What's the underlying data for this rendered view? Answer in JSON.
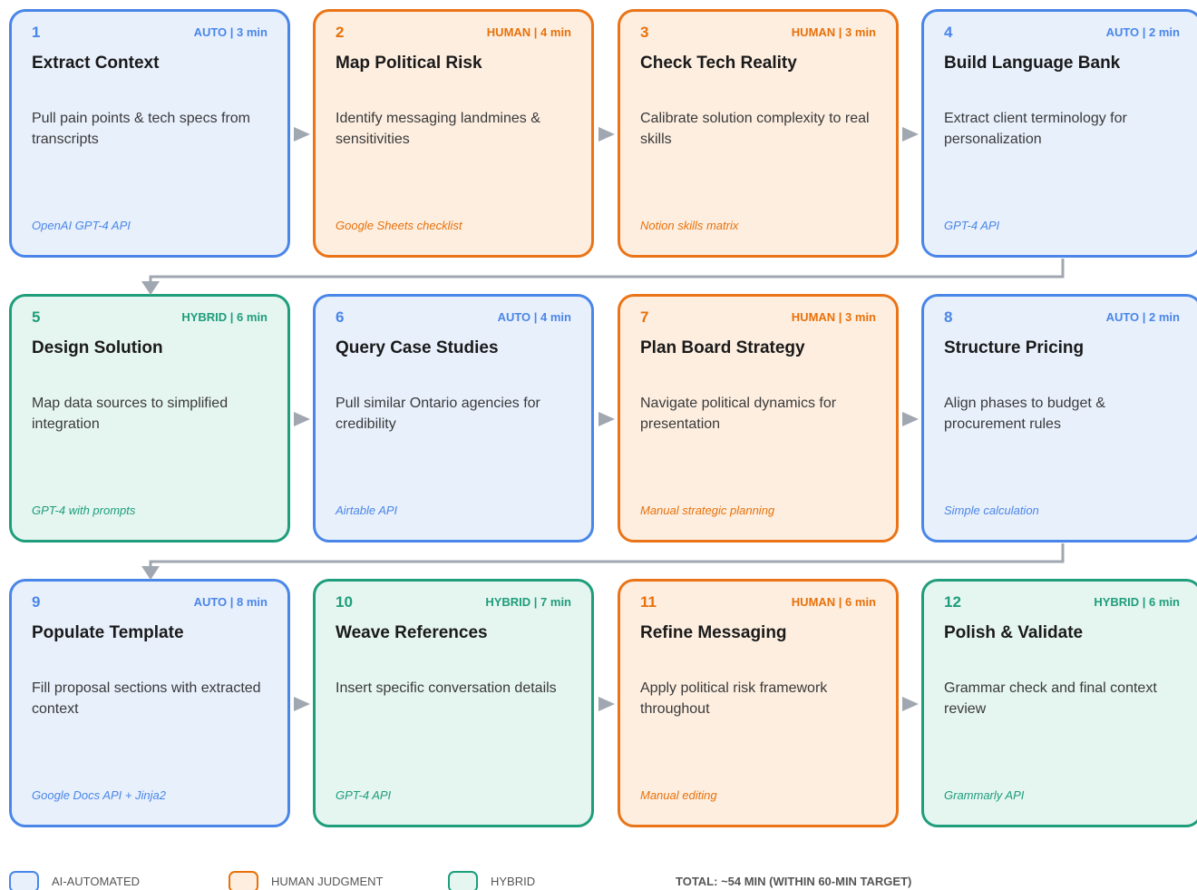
{
  "steps": [
    {
      "num": "1",
      "meta": "AUTO | 3 min",
      "title": "Extract Context",
      "desc": "Pull pain points & tech specs from transcripts",
      "tool": "OpenAI GPT-4 API",
      "type": "auto"
    },
    {
      "num": "2",
      "meta": "HUMAN | 4 min",
      "title": "Map Political Risk",
      "desc": "Identify messaging landmines & sensitivities",
      "tool": "Google Sheets checklist",
      "type": "human"
    },
    {
      "num": "3",
      "meta": "HUMAN | 3 min",
      "title": "Check Tech Reality",
      "desc": "Calibrate solution complexity to real skills",
      "tool": "Notion skills matrix",
      "type": "human"
    },
    {
      "num": "4",
      "meta": "AUTO | 2 min",
      "title": "Build Language Bank",
      "desc": "Extract client terminology for personalization",
      "tool": "GPT-4 API",
      "type": "auto"
    },
    {
      "num": "5",
      "meta": "HYBRID | 6 min",
      "title": "Design Solution",
      "desc": "Map data sources to simplified integration",
      "tool": "GPT-4 with prompts",
      "type": "hybrid"
    },
    {
      "num": "6",
      "meta": "AUTO | 4 min",
      "title": "Query Case Studies",
      "desc": "Pull similar Ontario agencies for credibility",
      "tool": "Airtable API",
      "type": "auto"
    },
    {
      "num": "7",
      "meta": "HUMAN | 3 min",
      "title": "Plan Board Strategy",
      "desc": "Navigate political dynamics for presentation",
      "tool": "Manual strategic planning",
      "type": "human"
    },
    {
      "num": "8",
      "meta": "AUTO | 2 min",
      "title": "Structure Pricing",
      "desc": "Align phases to budget & procurement rules",
      "tool": "Simple calculation",
      "type": "auto"
    },
    {
      "num": "9",
      "meta": "AUTO | 8 min",
      "title": "Populate Template",
      "desc": "Fill proposal sections with extracted context",
      "tool": "Google Docs API + Jinja2",
      "type": "auto"
    },
    {
      "num": "10",
      "meta": "HYBRID | 7 min",
      "title": "Weave References",
      "desc": "Insert specific conversation details",
      "tool": "GPT-4 API",
      "type": "hybrid"
    },
    {
      "num": "11",
      "meta": "HUMAN | 6 min",
      "title": "Refine Messaging",
      "desc": "Apply political risk framework throughout",
      "tool": "Manual editing",
      "type": "human"
    },
    {
      "num": "12",
      "meta": "HYBRID | 6 min",
      "title": "Polish & Validate",
      "desc": "Grammar check and final context review",
      "tool": "Grammarly API",
      "type": "hybrid"
    }
  ],
  "legend": {
    "auto_label": "AI-AUTOMATED",
    "human_label": "HUMAN JUDGMENT",
    "hybrid_label": "HYBRID",
    "total": "TOTAL: ~54 MIN (WITHIN 60-MIN TARGET)"
  },
  "colors": {
    "auto": "#4a86e8",
    "human": "#e8710a",
    "hybrid": "#1e9e7b",
    "connector": "#a0a7b0"
  }
}
